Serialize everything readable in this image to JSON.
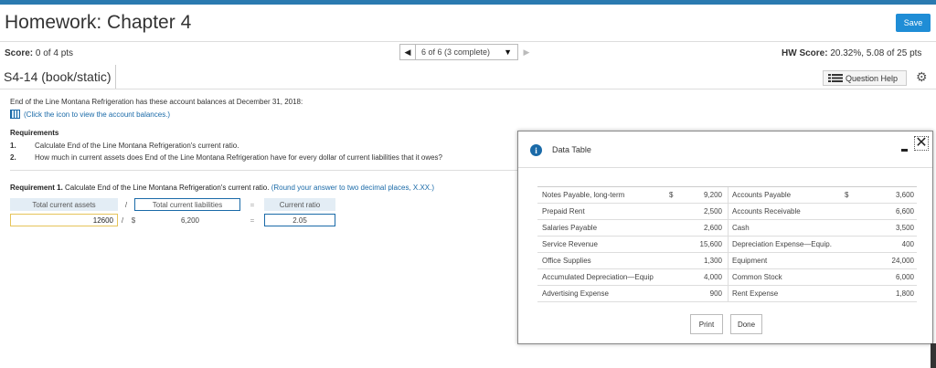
{
  "header": {
    "title": "Homework: Chapter 4",
    "save_label": "Save"
  },
  "score": {
    "label": "Score:",
    "value": "0 of 4 pts"
  },
  "pager": {
    "prev": "◀",
    "selected": "6 of 6 (3 complete)",
    "caret": "▼",
    "next": "▶"
  },
  "hw_score": {
    "label": "HW Score:",
    "value": "20.32%, 5.08 of 25 pts"
  },
  "question": {
    "id": "S4-14 (book/static)",
    "help_label": "Question Help",
    "intro": "End of the Line Montana Refrigeration has these account balances at December 31, 2018:",
    "click_link": "(Click the icon to view the account balances.)",
    "requirements_title": "Requirements",
    "requirements": [
      {
        "num": "1.",
        "text": "Calculate End of the Line Montana Refrigeration's current ratio."
      },
      {
        "num": "2.",
        "text": "How much in current assets does End of the Line Montana Refrigeration have for every dollar of current liabilities that it owes?"
      }
    ],
    "req1_label": "Requirement 1.",
    "req1_text": "Calculate End of the Line Montana Refrigeration's current ratio.",
    "req1_hint": "(Round your answer to two decimal places, X.XX.)"
  },
  "calc": {
    "h_assets": "Total current assets",
    "h_div": "/",
    "h_liab": "Total current liabilities",
    "h_eq": "=",
    "h_ratio": "Current ratio",
    "v_assets": "12600",
    "v_div": "/",
    "v_dollar": "$",
    "v_liab": "6,200",
    "v_eq": "=",
    "v_ratio": "2.05"
  },
  "modal": {
    "title": "Data Table",
    "rows": [
      {
        "l_name": "Notes Payable, long-term",
        "l_dollar": "$",
        "l_val": "9,200",
        "r_name": "Accounts Payable",
        "r_dollar": "$",
        "r_val": "3,600"
      },
      {
        "l_name": "Prepaid Rent",
        "l_dollar": "",
        "l_val": "2,500",
        "r_name": "Accounts Receivable",
        "r_dollar": "",
        "r_val": "6,600"
      },
      {
        "l_name": "Salaries Payable",
        "l_dollar": "",
        "l_val": "2,600",
        "r_name": "Cash",
        "r_dollar": "",
        "r_val": "3,500"
      },
      {
        "l_name": "Service Revenue",
        "l_dollar": "",
        "l_val": "15,600",
        "r_name": "Depreciation Expense—Equip.",
        "r_dollar": "",
        "r_val": "400"
      },
      {
        "l_name": "Office Supplies",
        "l_dollar": "",
        "l_val": "1,300",
        "r_name": "Equipment",
        "r_dollar": "",
        "r_val": "24,000"
      },
      {
        "l_name": "Accumulated Depreciation—Equip",
        "l_dollar": "",
        "l_val": "4,000",
        "r_name": "Common Stock",
        "r_dollar": "",
        "r_val": "6,000"
      },
      {
        "l_name": "Advertising Expense",
        "l_dollar": "",
        "l_val": "900",
        "r_name": "Rent Expense",
        "r_dollar": "",
        "r_val": "1,800"
      }
    ],
    "print_label": "Print",
    "done_label": "Done"
  },
  "icons": {
    "info": "i",
    "close": "✕",
    "gear": "⚙"
  },
  "colors": {
    "accent": "#1f8dd6",
    "link": "#1a6aa8",
    "header_cell": "#e3edf5"
  }
}
